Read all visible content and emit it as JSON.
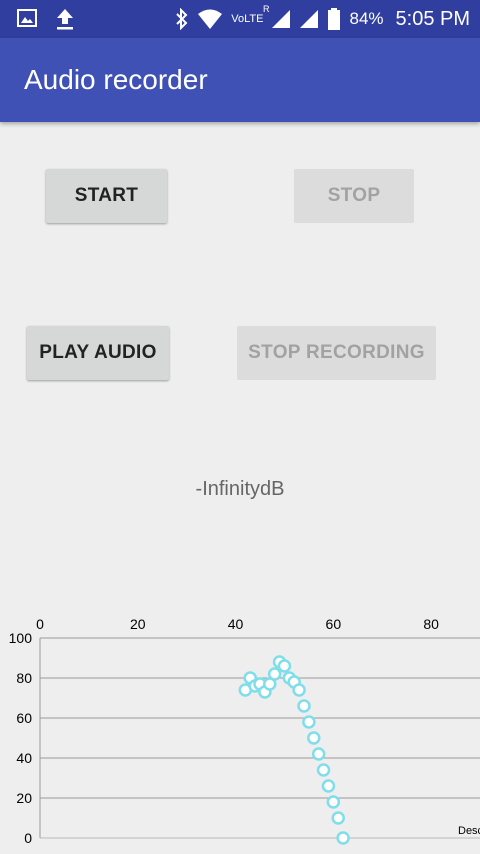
{
  "status": {
    "battery": "84%",
    "time": "5:05 PM",
    "network": "VoLTE",
    "roaming": "R",
    "left_icons": [
      "image-icon",
      "upload-icon"
    ],
    "right_icons": [
      "bluetooth-icon",
      "wifi-icon",
      "signal-icon",
      "signal-icon",
      "battery-icon"
    ]
  },
  "app": {
    "title": "Audio recorder"
  },
  "buttons": {
    "start": "START",
    "stop": "STOP",
    "play": "PLAY AUDIO",
    "stop_recording": "STOP RECORDING"
  },
  "level": "-InfinitydB",
  "chart_data": {
    "type": "scatter",
    "x_ticks": [
      "0",
      "20",
      "40",
      "60",
      "80"
    ],
    "y_ticks": [
      "100",
      "80",
      "60",
      "40",
      "20",
      "0"
    ],
    "xlim": [
      0,
      90
    ],
    "ylim": [
      0,
      100
    ],
    "grid": true,
    "legend_fragment": "Desc",
    "series": [
      {
        "color": "#80DEEA",
        "points": [
          [
            42,
            74
          ],
          [
            43,
            80
          ],
          [
            44,
            76
          ],
          [
            45,
            77
          ],
          [
            46,
            73
          ],
          [
            47,
            77
          ],
          [
            48,
            82
          ],
          [
            49,
            88
          ],
          [
            50,
            86
          ],
          [
            51,
            80
          ],
          [
            52,
            78
          ],
          [
            53,
            74
          ],
          [
            54,
            66
          ],
          [
            55,
            58
          ],
          [
            56,
            50
          ],
          [
            57,
            42
          ],
          [
            58,
            34
          ],
          [
            59,
            26
          ],
          [
            60,
            18
          ],
          [
            61,
            10
          ],
          [
            62,
            0
          ]
        ]
      }
    ]
  }
}
